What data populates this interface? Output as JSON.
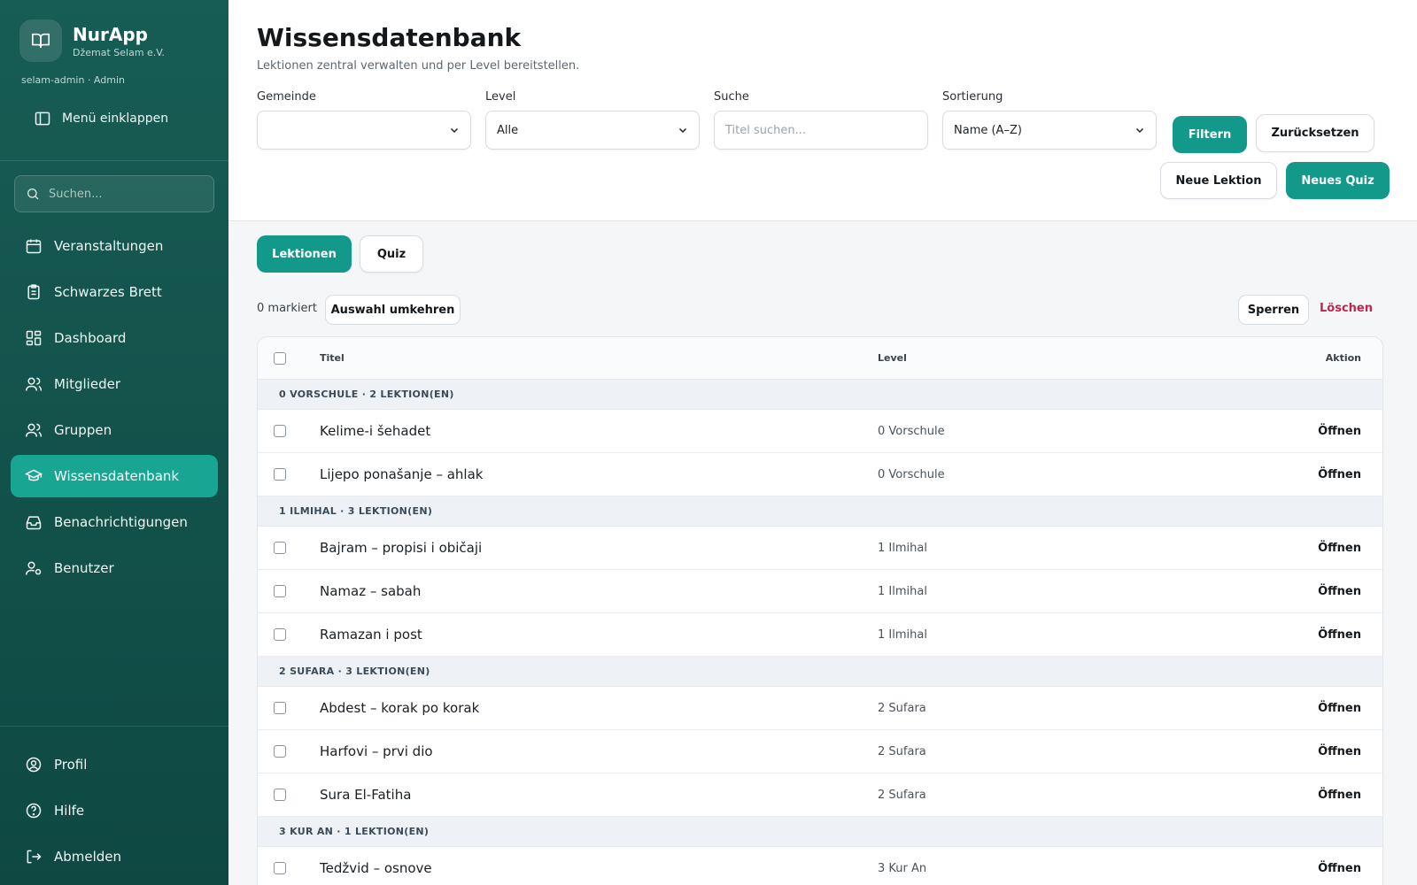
{
  "app": {
    "name": "NurApp",
    "org": "Džemat Selam e.V.",
    "user_line": "selam-admin · Admin",
    "collapse_label": "Menü einklappen",
    "search_placeholder": "Suchen..."
  },
  "nav": [
    {
      "label": "Veranstaltungen",
      "icon": "calendar-icon",
      "active": false
    },
    {
      "label": "Schwarzes Brett",
      "icon": "clipboard-icon",
      "active": false
    },
    {
      "label": "Dashboard",
      "icon": "dashboard-icon",
      "active": false
    },
    {
      "label": "Mitglieder",
      "icon": "users-icon",
      "active": false
    },
    {
      "label": "Gruppen",
      "icon": "group-icon",
      "active": false
    },
    {
      "label": "Wissensdatenbank",
      "icon": "graduation-cap-icon",
      "active": true
    },
    {
      "label": "Benachrichtigungen",
      "icon": "inbox-icon",
      "active": false
    },
    {
      "label": "Benutzer",
      "icon": "user-cog-icon",
      "active": false
    }
  ],
  "nav_bottom": [
    {
      "label": "Profil",
      "icon": "user-circle-icon"
    },
    {
      "label": "Hilfe",
      "icon": "help-icon"
    },
    {
      "label": "Abmelden",
      "icon": "logout-icon"
    }
  ],
  "header": {
    "title": "Wissensdatenbank",
    "subtitle": "Lektionen zentral verwalten und per Level bereitstellen.",
    "filters": {
      "gemeinde_label": "Gemeinde",
      "gemeinde_value": "",
      "level_label": "Level",
      "level_value": "Alle",
      "search_label": "Suche",
      "search_placeholder": "Titel suchen...",
      "sort_label": "Sortierung",
      "sort_value": "Name (A–Z)"
    },
    "filter_button": "Filtern",
    "reset_button": "Zurücksetzen",
    "new_lesson_button": "Neue Lektion",
    "new_quiz_button": "Neues Quiz"
  },
  "tabs": {
    "lessons": "Lektionen",
    "quiz": "Quiz"
  },
  "bulk": {
    "count_text": "0 markiert",
    "invert_label": "Auswahl umkehren",
    "lock_label": "Sperren",
    "delete_label": "Löschen"
  },
  "table": {
    "headers": {
      "title": "Titel",
      "level": "Level",
      "action": "Aktion"
    },
    "groups": [
      {
        "label": "0 VORSCHULE · 2 LEKTION(EN)",
        "rows": [
          {
            "title": "Kelime-i šehadet",
            "level": "0 Vorschule",
            "action": "Öffnen"
          },
          {
            "title": "Lijepo ponašanje – ahlak",
            "level": "0 Vorschule",
            "action": "Öffnen"
          }
        ]
      },
      {
        "label": "1 ILMIHAL · 3 LEKTION(EN)",
        "rows": [
          {
            "title": "Bajram – propisi i običaji",
            "level": "1 Ilmihal",
            "action": "Öffnen"
          },
          {
            "title": "Namaz – sabah",
            "level": "1 Ilmihal",
            "action": "Öffnen"
          },
          {
            "title": "Ramazan i post",
            "level": "1 Ilmihal",
            "action": "Öffnen"
          }
        ]
      },
      {
        "label": "2 SUFARA · 3 LEKTION(EN)",
        "rows": [
          {
            "title": "Abdest – korak po korak",
            "level": "2 Sufara",
            "action": "Öffnen"
          },
          {
            "title": "Harfovi – prvi dio",
            "level": "2 Sufara",
            "action": "Öffnen"
          },
          {
            "title": "Sura El-Fatiha",
            "level": "2 Sufara",
            "action": "Öffnen"
          }
        ]
      },
      {
        "label": "3 KUR AN · 1 LEKTION(EN)",
        "rows": [
          {
            "title": "Tedžvid – osnove",
            "level": "3 Kur An",
            "action": "Öffnen"
          }
        ]
      }
    ]
  },
  "colors": {
    "sidebar": "#175d55",
    "accent": "#13998a",
    "active_nav": "#18a693",
    "danger": "#c0264b"
  }
}
